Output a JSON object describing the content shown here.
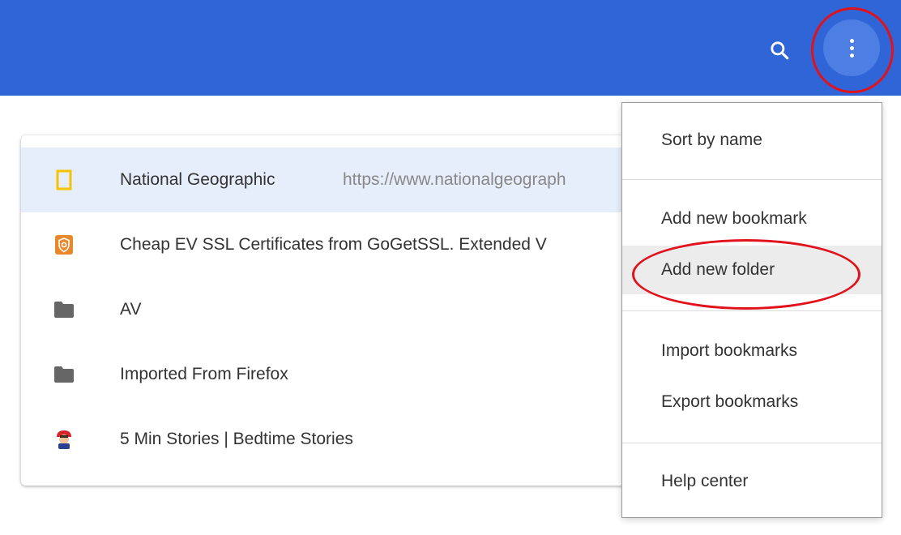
{
  "toolbar": {
    "background": "#3065d8",
    "search_icon": "search-icon",
    "more_icon": "more-vert-icon"
  },
  "bookmarks": {
    "items": [
      {
        "title": "National Geographic",
        "url": "https://www.nationalgeograph",
        "icon": "natgeo-favicon",
        "selected": true
      },
      {
        "title": "Cheap EV SSL Certificates from GoGetSSL. Extended V",
        "url": "",
        "icon": "gogetssl-favicon",
        "selected": false
      },
      {
        "title": "AV",
        "url": "",
        "icon": "folder-icon",
        "selected": false
      },
      {
        "title": "Imported From Firefox",
        "url": "",
        "icon": "folder-icon",
        "selected": false
      },
      {
        "title": "5 Min Stories | Bedtime Stories",
        "url": "",
        "icon": "stories-favicon",
        "selected": false
      }
    ]
  },
  "menu": {
    "sort_by_name": "Sort by name",
    "add_new_bookmark": "Add new bookmark",
    "add_new_folder": "Add new folder",
    "import_bookmarks": "Import bookmarks",
    "export_bookmarks": "Export bookmarks",
    "help_center": "Help center"
  },
  "annotation_color": "#e0121b"
}
